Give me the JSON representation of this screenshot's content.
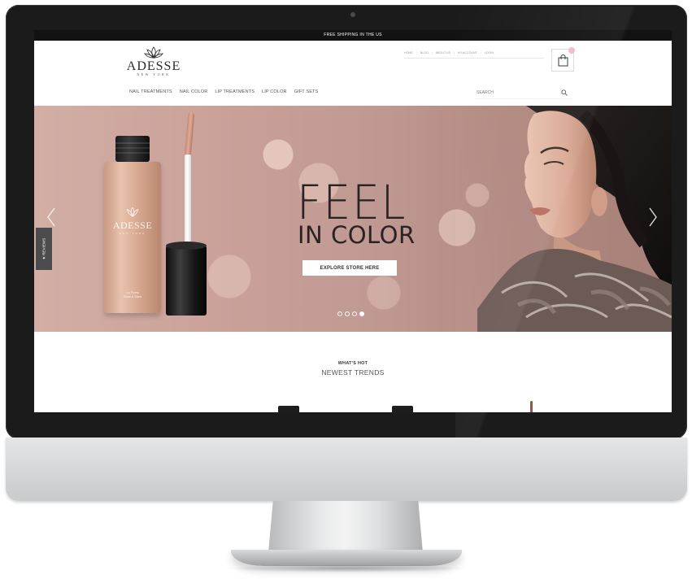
{
  "topbar": {
    "shipping_text": "FREE SHIPPING IN THE US"
  },
  "brand": {
    "name": "ADESSE",
    "subtitle": "NEW YORK"
  },
  "top_links": [
    "HOME",
    "BLOG",
    "ABOUT US",
    "MY ACCOUNT",
    "LOGIN"
  ],
  "nav": {
    "items": [
      "NAIL TREATMENTS",
      "NAIL COLOR",
      "LIP TREATMENTS",
      "LIP COLOR",
      "GIFT SETS"
    ],
    "search_label": "SEARCH"
  },
  "sidebar": {
    "reviews_label": "★ REVIEWS"
  },
  "hero": {
    "title_line1": "FEEL",
    "title_line2": "IN COLOR",
    "cta_label": "EXPLORE STORE HERE",
    "product_brand": "ADESSE",
    "product_sub": "NEW YORK",
    "product_desc_1": "Lip Plump",
    "product_desc_2": "Gloss & Shine",
    "slides_total": 4,
    "active_slide": 4
  },
  "section": {
    "kicker": "WHAT'S HOT",
    "title": "NEWEST TRENDS"
  },
  "colors": {
    "accent_pink": "#f2bccb",
    "hero_bg": "#c9a199",
    "bar_black": "#121212"
  },
  "icons": [
    "lotus-logo-icon",
    "shopping-bag-icon",
    "search-icon",
    "chevron-left-icon",
    "chevron-right-icon"
  ]
}
